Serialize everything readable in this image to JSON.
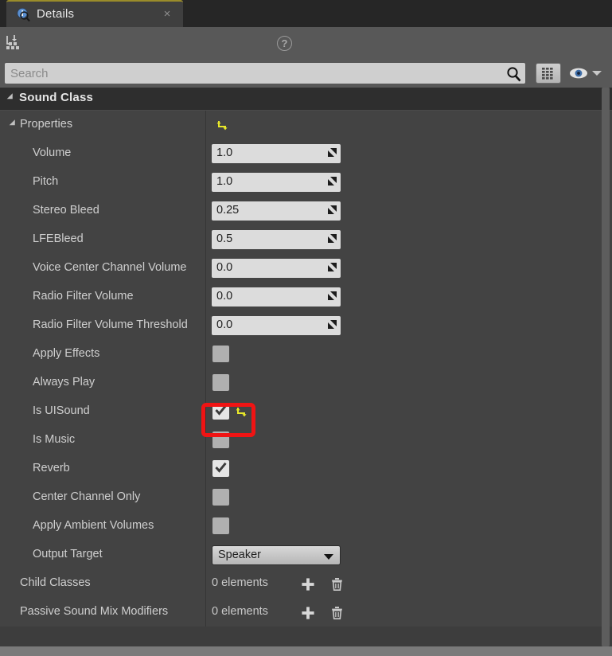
{
  "tab": {
    "title": "Details",
    "icon": "details-info-search-icon",
    "close_label": "×"
  },
  "toolbar": {
    "filter_icon": "filter-hierarchy-icon",
    "help_icon": "help-question-icon",
    "help_label": "?"
  },
  "search": {
    "placeholder": "Search",
    "value": "",
    "search_icon": "search-magnifier-icon",
    "grid_icon": "grid-view-icon",
    "eye_icon": "visibility-eye-icon",
    "caret_icon": "chevron-down-icon"
  },
  "category": {
    "title": "Sound Class"
  },
  "properties_group": {
    "label": "Properties",
    "has_reset": true
  },
  "rows": [
    {
      "label": "Volume",
      "type": "number",
      "value": "1.0"
    },
    {
      "label": "Pitch",
      "type": "number",
      "value": "1.0"
    },
    {
      "label": "Stereo Bleed",
      "type": "number",
      "value": "0.25"
    },
    {
      "label": "LFEBleed",
      "type": "number",
      "value": "0.5"
    },
    {
      "label": "Voice Center Channel Volume",
      "type": "number",
      "value": "0.0"
    },
    {
      "label": "Radio Filter Volume",
      "type": "number",
      "value": "0.0"
    },
    {
      "label": "Radio Filter Volume Threshold",
      "type": "number",
      "value": "0.0"
    },
    {
      "label": "Apply Effects",
      "type": "checkbox",
      "checked": false
    },
    {
      "label": "Always Play",
      "type": "checkbox",
      "checked": false
    },
    {
      "label": "Is UISound",
      "type": "checkbox",
      "checked": true,
      "has_reset": true,
      "highlighted": true
    },
    {
      "label": "Is Music",
      "type": "checkbox",
      "checked": false
    },
    {
      "label": "Reverb",
      "type": "checkbox",
      "checked": true
    },
    {
      "label": "Center Channel Only",
      "type": "checkbox",
      "checked": false
    },
    {
      "label": "Apply Ambient Volumes",
      "type": "checkbox",
      "checked": false
    },
    {
      "label": "Output Target",
      "type": "select",
      "value": "Speaker"
    }
  ],
  "array_rows": [
    {
      "label": "Child Classes",
      "count": "0 elements"
    },
    {
      "label": "Passive Sound Mix Modifiers",
      "count": "0 elements"
    }
  ],
  "icons": {
    "reset": "reset-arrow-icon",
    "plus": "add-element-icon",
    "trash": "delete-all-elements-icon",
    "drag": "drag-value-icon",
    "check": "checkmark-icon"
  },
  "colors": {
    "accent_yellow": "#e8e82a",
    "highlight_red": "#f01414",
    "panel_bg": "#3d3d3d",
    "row_bg": "#434343",
    "header_bg": "#2e2e2e"
  }
}
